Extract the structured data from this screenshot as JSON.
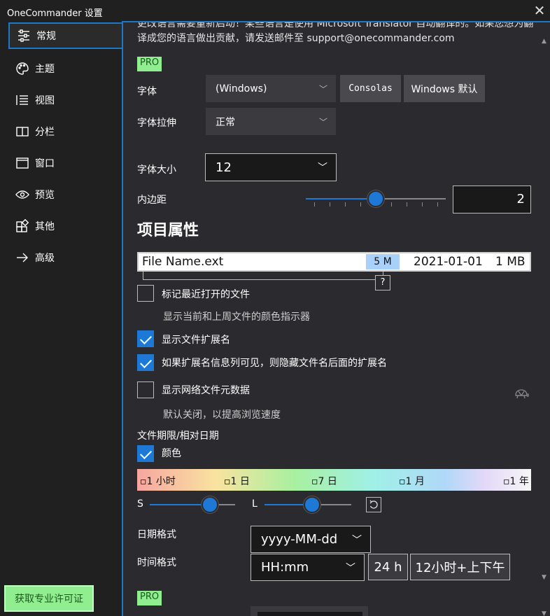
{
  "window": {
    "title": "OneCommander 设置",
    "close_glyph": "✕"
  },
  "sidebar": {
    "items": [
      {
        "label": "常规",
        "icon": "sliders-icon",
        "active": true
      },
      {
        "label": "主题",
        "icon": "palette-icon"
      },
      {
        "label": "视图",
        "icon": "list-view-icon"
      },
      {
        "label": "分栏",
        "icon": "columns-icon"
      },
      {
        "label": "窗口",
        "icon": "window-icon"
      },
      {
        "label": "预览",
        "icon": "eye-icon"
      },
      {
        "label": "其他",
        "icon": "puzzle-icon"
      },
      {
        "label": "高级",
        "icon": "arrow-right-icon"
      }
    ],
    "pro_license_button": "获取专业许可证"
  },
  "general": {
    "restart_note": "更改语言需要重新启动！某些语言是使用 Microsoft Translator 自动翻译的。如果您想为翻译成您的语言做出贡献，请发送邮件至 support@onecommander.com",
    "pro_badge": "PRO",
    "font": {
      "label": "字体",
      "value": "(Windows)",
      "btn_consolas": "Consolas",
      "btn_windows_default": "Windows 默认"
    },
    "font_stretch": {
      "label": "字体拉伸",
      "value": "正常"
    },
    "font_size": {
      "label": "字体大小",
      "value": "12"
    },
    "padding": {
      "label": "内边距",
      "value": "2",
      "level": 0.5
    },
    "item_properties": {
      "title": "项目属性",
      "preview": {
        "file_name": "File Name.ext",
        "badge": "5 M",
        "date": "2021-01-01",
        "size": "1 MB",
        "help": "?"
      },
      "mark_recent": {
        "label": "标记最近打开的文件",
        "checked": false,
        "sub": "显示当前和上周文件的颜色指示器"
      },
      "show_ext": {
        "label": "显示文件扩展名",
        "checked": true
      },
      "hide_ext": {
        "label": "如果扩展名信息列可见，则隐藏文件名后面的扩展名",
        "checked": true
      },
      "network_meta": {
        "label": "显示网络文件元数据",
        "checked": false,
        "sub": "默认关闭，以提高浏览速度",
        "icon": "turtle-icon"
      }
    },
    "file_age": {
      "label": "文件期限/相对日期",
      "color": {
        "label": "颜色",
        "checked": true
      },
      "scale": [
        "▫1 小时",
        "▫1 日",
        "▫7 日",
        "▫1 月",
        "▫1 年"
      ],
      "s_label": "S",
      "l_label": "L",
      "s_level": 0.75,
      "l_level": 0.56,
      "reset_icon": "reset-icon"
    },
    "date_format": {
      "label": "日期格式",
      "value": "yyyy-MM-dd"
    },
    "time_format": {
      "label": "时间格式",
      "value": "HH:mm",
      "btn_24h": "24 h",
      "btn_12h": "12小时+上下午"
    },
    "pro_badge_2": "PRO"
  },
  "colors": {
    "accent": "#1e78d6",
    "pro": "#90ee90",
    "panel": "#2b2a2e",
    "window": "#202020"
  }
}
